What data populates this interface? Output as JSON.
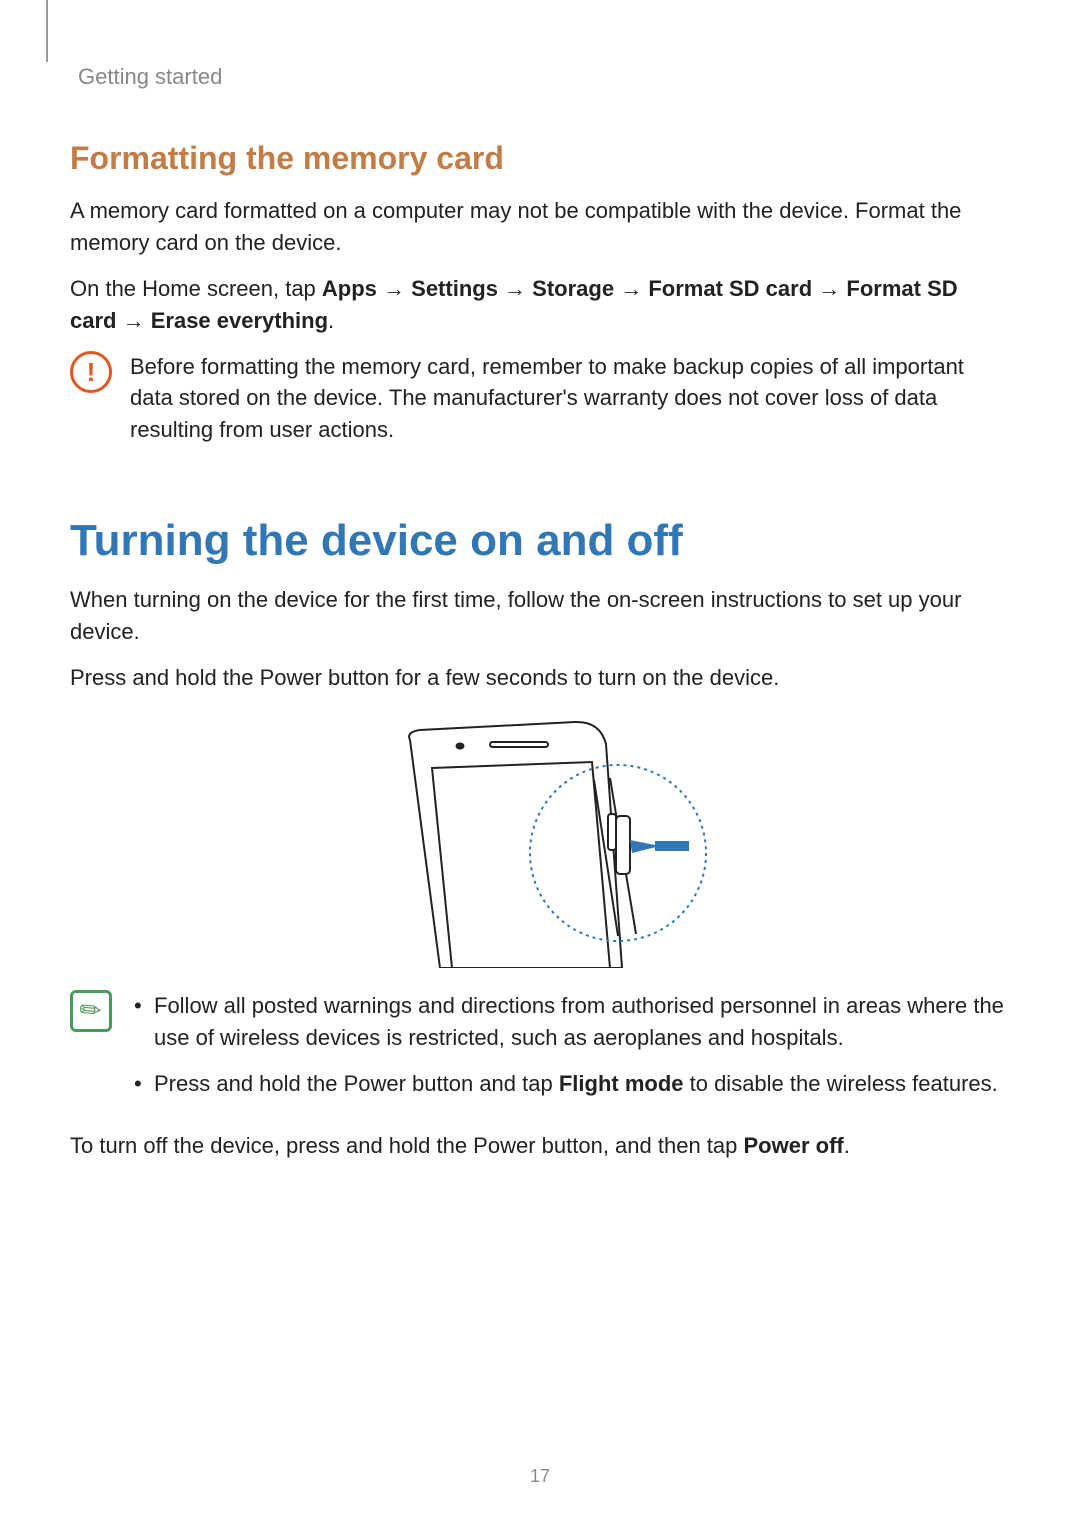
{
  "header": {
    "section": "Getting started"
  },
  "s1": {
    "heading": "Formatting the memory card",
    "p1": "A memory card formatted on a computer may not be compatible with the device. Format the memory card on the device.",
    "path_prefix": "On the Home screen, tap ",
    "path": {
      "apps": "Apps",
      "settings": "Settings",
      "storage": "Storage",
      "format1": "Format SD card",
      "format2": "Format SD card",
      "erase": "Erase everything"
    },
    "arrow": " → ",
    "period": ".",
    "caution": "Before formatting the memory card, remember to make backup copies of all important data stored on the device. The manufacturer's warranty does not cover loss of data resulting from user actions."
  },
  "s2": {
    "heading": "Turning the device on and off",
    "p1": "When turning on the device for the first time, follow the on-screen instructions to set up your device.",
    "p2": "Press and hold the Power button for a few seconds to turn on the device.",
    "note_b1": "Follow all posted warnings and directions from authorised personnel in areas where the use of wireless devices is restricted, such as aeroplanes and hospitals.",
    "note_b2_a": "Press and hold the Power button and tap ",
    "note_b2_bold": "Flight mode",
    "note_b2_b": " to disable the wireless features.",
    "p3_a": "To turn off the device, press and hold the Power button, and then tap ",
    "p3_bold": "Power off",
    "p3_b": "."
  },
  "page_number": "17"
}
